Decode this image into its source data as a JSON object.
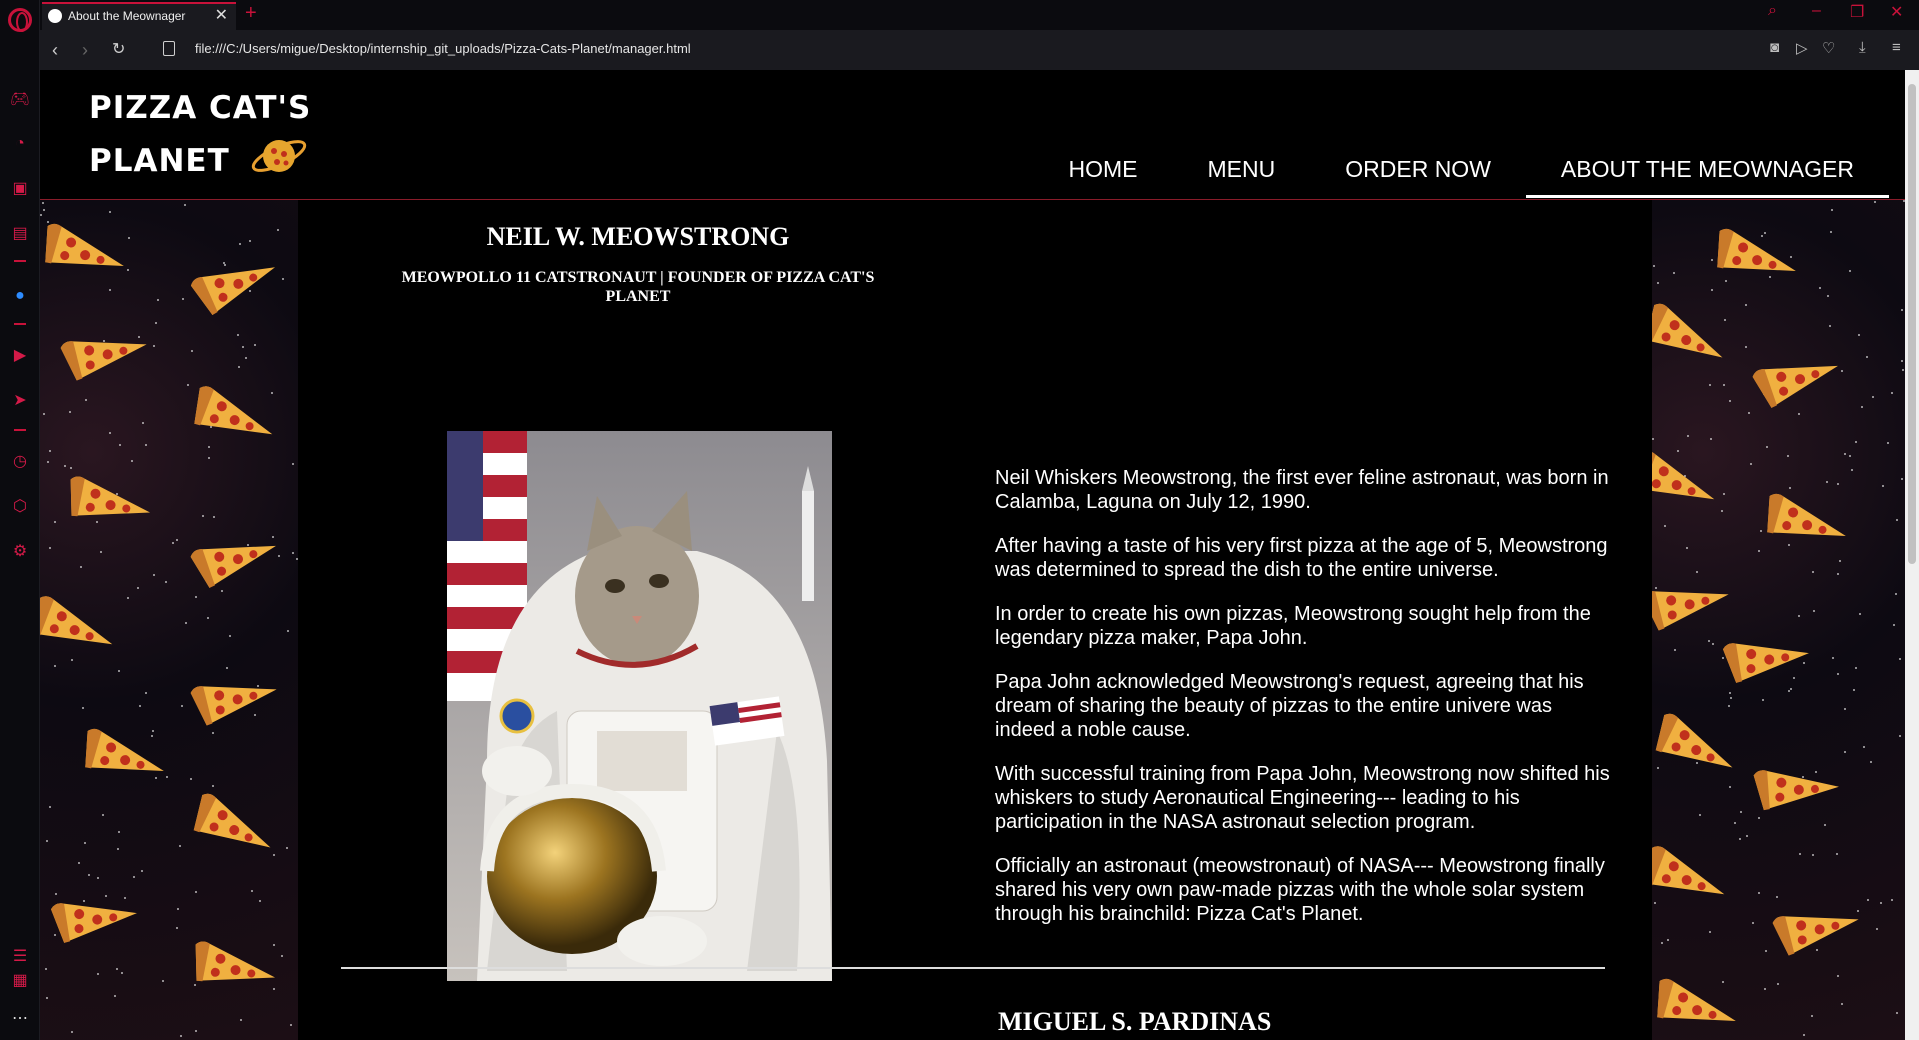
{
  "browser": {
    "tab_title": "About the Meownager",
    "url": "file:///C:/Users/migue/Desktop/internship_git_uploads/Pizza-Cats-Planet/manager.html"
  },
  "site": {
    "logo_line1": "PIZZA CAT'S",
    "logo_line2": "PLANET",
    "nav": [
      {
        "label": "HOME"
      },
      {
        "label": "MENU"
      },
      {
        "label": "ORDER NOW"
      },
      {
        "label": "ABOUT THE MEOWNAGER",
        "active": true
      }
    ]
  },
  "person1": {
    "name": "NEIL W. MEOWSTRONG",
    "title": "MEOWPOLLO 11 CATSTRONAUT | FOUNDER OF PIZZA CAT'S PLANET",
    "bio": [
      "Neil Whiskers Meowstrong, the first ever feline astronaut, was born in Calamba, Laguna on July 12, 1990.",
      "After having a taste of his very first pizza at the age of 5, Meowstrong was determined to spread the dish to the entire universe.",
      "In order to create his own pizzas, Meowstrong sought help from the legendary pizza maker, Papa John.",
      "Papa John acknowledged Meowstrong's request, agreeing that his dream of sharing the beauty of pizzas to the entire univere was indeed a noble cause.",
      "With successful training from Papa John, Meowstrong now shifted his whiskers to study Aeronautical Engineering--- leading to his participation in the NASA astronaut selection program.",
      "Officially an astronaut (meowstronaut) of NASA--- Meowstrong finally shared his very own paw-made pizzas with the whole solar system through his brainchild: Pizza Cat's Planet."
    ]
  },
  "person2": {
    "name": "MIGUEL S. PARDINAS"
  },
  "colors": {
    "accent": "#c8123a",
    "background": "#000000",
    "text": "#ffffff"
  }
}
